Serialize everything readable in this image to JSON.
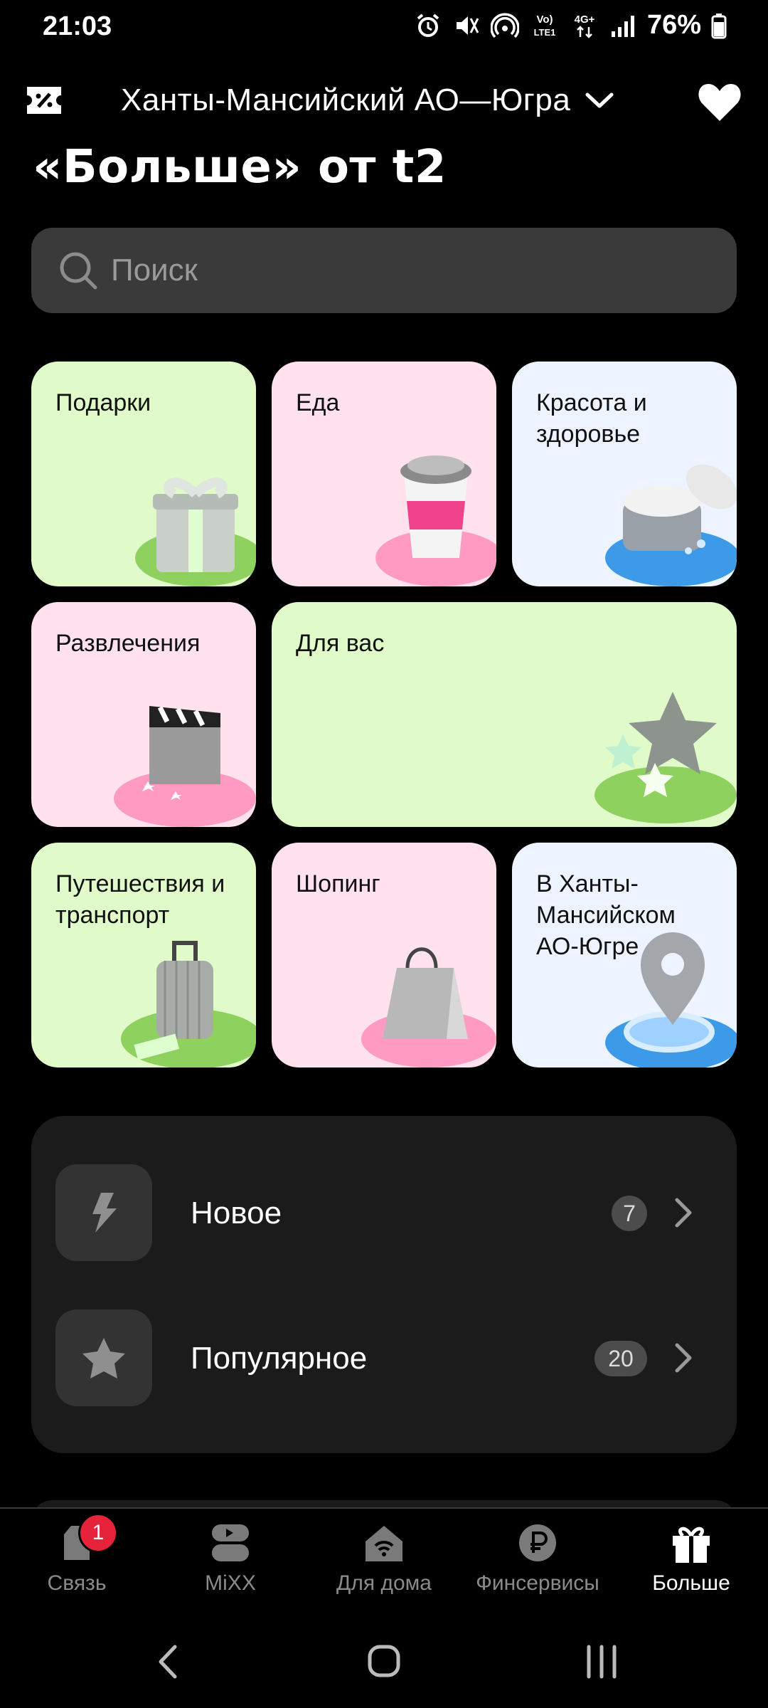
{
  "status": {
    "time": "21:03",
    "battery": "76%",
    "net_label": "LTE1",
    "net_top": "Vo)",
    "gen": "4G+"
  },
  "header": {
    "region": "Ханты-Мансийский АО—Югра"
  },
  "title": "«Больше» от t2",
  "search": {
    "placeholder": "Поиск"
  },
  "categories": [
    {
      "label": "Подарки"
    },
    {
      "label": "Еда"
    },
    {
      "label": "Красота и здоровье"
    },
    {
      "label": "Развлечения"
    },
    {
      "label": "Для вас"
    },
    {
      "label": "Путешествия и транспорт"
    },
    {
      "label": "Шопинг"
    },
    {
      "label": "В Ханты-Мансийском АО-Югре"
    }
  ],
  "lists": [
    {
      "label": "Новое",
      "count": "7",
      "icon": "lightning-icon"
    },
    {
      "label": "Популярное",
      "count": "20",
      "icon": "star-icon"
    }
  ],
  "tabs": [
    {
      "label": "Связь",
      "badge": "1"
    },
    {
      "label": "MiXX"
    },
    {
      "label": "Для дома"
    },
    {
      "label": "Финсервисы"
    },
    {
      "label": "Больше",
      "active": true
    }
  ],
  "colors": {
    "accent_green": "#e0fbc9",
    "accent_pink": "#ffe2ee",
    "accent_blue": "#eef4ff",
    "badge_red": "#e5243b"
  }
}
